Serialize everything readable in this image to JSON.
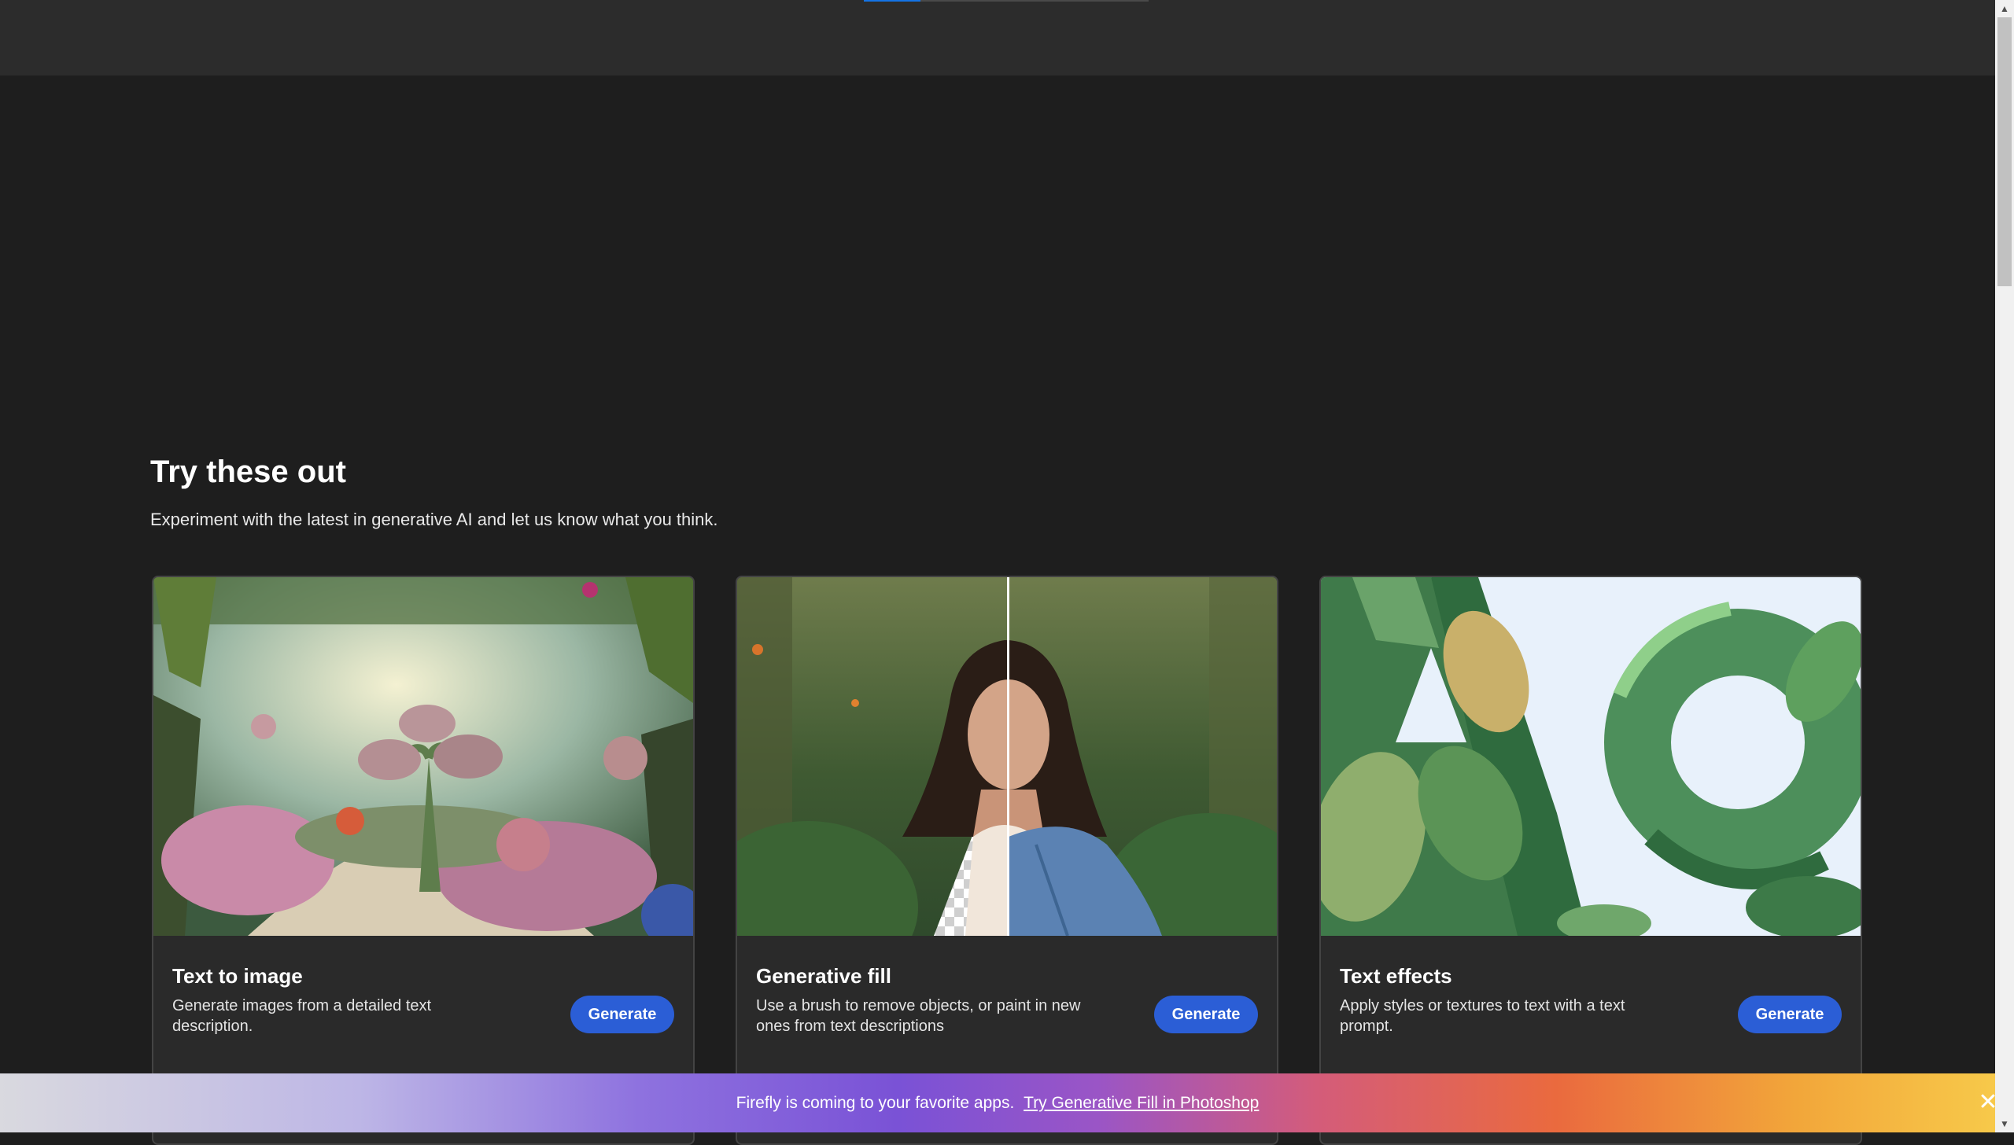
{
  "section": {
    "title": "Try these out",
    "subtitle": "Experiment with the latest in generative AI and let us know what you think."
  },
  "cards": [
    {
      "title": "Text to image",
      "description": "Generate images from a detailed text description.",
      "button_label": "Generate"
    },
    {
      "title": "Generative fill",
      "description": "Use a brush to remove objects, or paint in new ones from text descriptions",
      "button_label": "Generate"
    },
    {
      "title": "Text effects",
      "description": "Apply styles or textures to text with a text prompt.",
      "button_label": "Generate"
    }
  ],
  "banner": {
    "text": "Firefly is coming to your favorite apps.",
    "link": "Try Generative Fill in Photoshop",
    "close_glyph": "✕"
  },
  "scrollbar": {
    "up_glyph": "▲",
    "down_glyph": "▼"
  },
  "colors": {
    "background": "#1e1e1e",
    "topbar": "#2c2c2c",
    "accent": "#1473e6",
    "button": "#2b5ed6"
  }
}
